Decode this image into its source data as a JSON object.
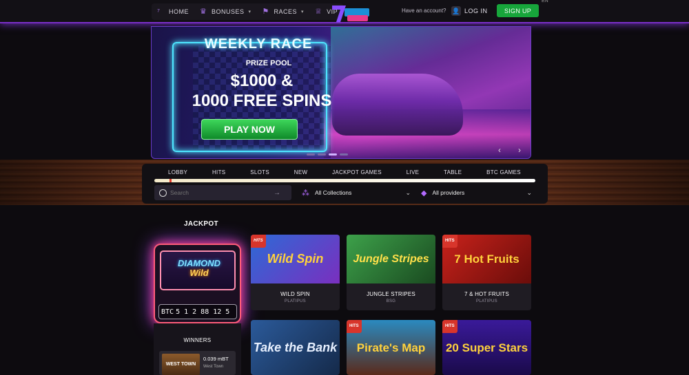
{
  "header": {
    "nav": [
      {
        "label": "HOME",
        "icon": "seven-logo-icon"
      },
      {
        "label": "BONUSES",
        "icon": "crown-icon",
        "dropdown": true
      },
      {
        "label": "RACES",
        "icon": "race-flag-icon",
        "dropdown": true
      },
      {
        "label": "VIP",
        "icon": "vip-crown-icon"
      }
    ],
    "have_account": "Have an account?",
    "login_label": "LOG IN",
    "signup_label": "SIGN UP",
    "language": "EN"
  },
  "banner": {
    "title": "WEEKLY RACE",
    "subtitle": "PRIZE POOL",
    "amount_line1": "$1000 &",
    "amount_line2": "1000 FREE SPINS",
    "cta": "PLAY NOW",
    "prev": "‹",
    "next": "›"
  },
  "categories": [
    "LOBBY",
    "HITS",
    "SLOTS",
    "NEW",
    "JACKPOT GAMES",
    "LIVE",
    "TABLE",
    "BTC GAMES"
  ],
  "filters": {
    "search_placeholder": "Search",
    "collections_label": "All Collections",
    "providers_label": "All providers"
  },
  "jackpot": {
    "title": "JACKPOT",
    "game_logo_line1": "DIAMOND",
    "game_logo_line2": "Wild",
    "currency": "BTC",
    "amount_digits": "5 1 2 88 12 5",
    "winners_label": "WINNERS",
    "winner": {
      "game_thumb": "WEST TOWN",
      "amount": "0.039 mBT",
      "game": "West Town"
    }
  },
  "games": [
    {
      "name": "WILD SPIN",
      "provider": "PLATIPUS",
      "art": "Wild Spin",
      "badge": "HITS",
      "colors": [
        "#2d6ad6",
        "#7a2fbf"
      ]
    },
    {
      "name": "JUNGLE STRIPES",
      "provider": "BSG",
      "art": "Jungle Stripes",
      "badge": "",
      "colors": [
        "#2f8a3c",
        "#1a4a20"
      ]
    },
    {
      "name": "7 & HOT FRUITS",
      "provider": "PLATIPUS",
      "art": "7 Hot Fruits",
      "badge": "HITS",
      "colors": [
        "#c8221b",
        "#6a0d0a"
      ]
    },
    {
      "name": "",
      "provider": "",
      "art": "Take the Bank",
      "badge": "",
      "colors": [
        "#2b5a9a",
        "#152a4a"
      ]
    },
    {
      "name": "",
      "provider": "",
      "art": "Pirate's Map",
      "badge": "HITS",
      "colors": [
        "#2a8ac0",
        "#5a2a1a"
      ]
    },
    {
      "name": "",
      "provider": "",
      "art": "20 Super Stars",
      "badge": "HITS",
      "colors": [
        "#3a1a9a",
        "#1a0a4a"
      ]
    }
  ]
}
